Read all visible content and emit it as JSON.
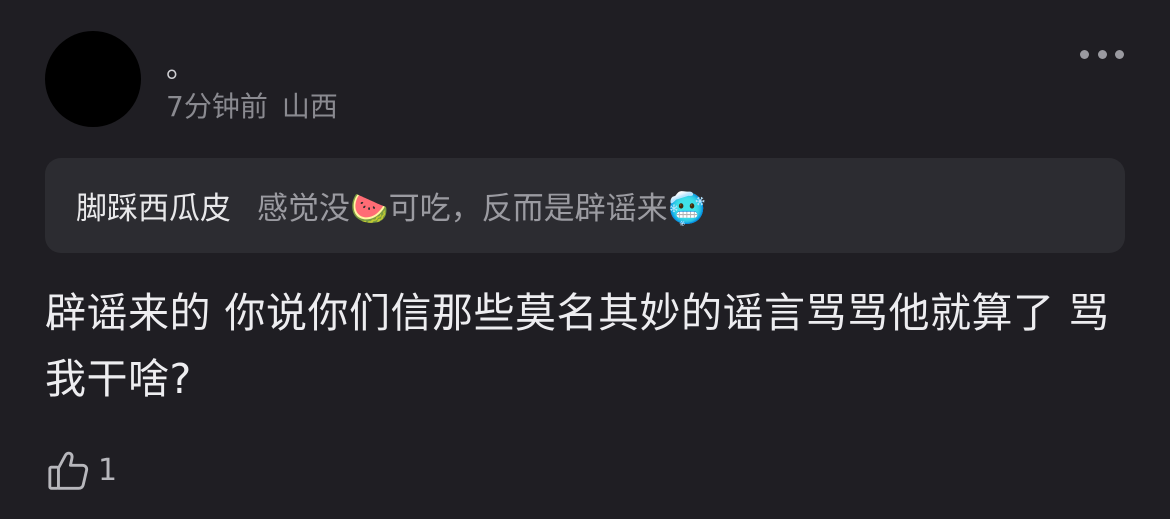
{
  "post": {
    "username": "。",
    "time": "7分钟前",
    "location": "山西",
    "quote": {
      "author": "脚踩西瓜皮",
      "text": "感觉没🍉可吃，反而是辟谣来🥶"
    },
    "content": "辟谣来的 你说你们信那些莫名其妙的谣言骂骂他就算了 骂我干啥?",
    "like_count": "1",
    "icons": {
      "more": "more-dots-icon",
      "like": "thumbs-up-icon"
    }
  },
  "colors": {
    "background": "#1f1e23",
    "quote_background": "#2c2c31",
    "primary_text": "#ededf0",
    "secondary_text": "#8a8a90"
  }
}
